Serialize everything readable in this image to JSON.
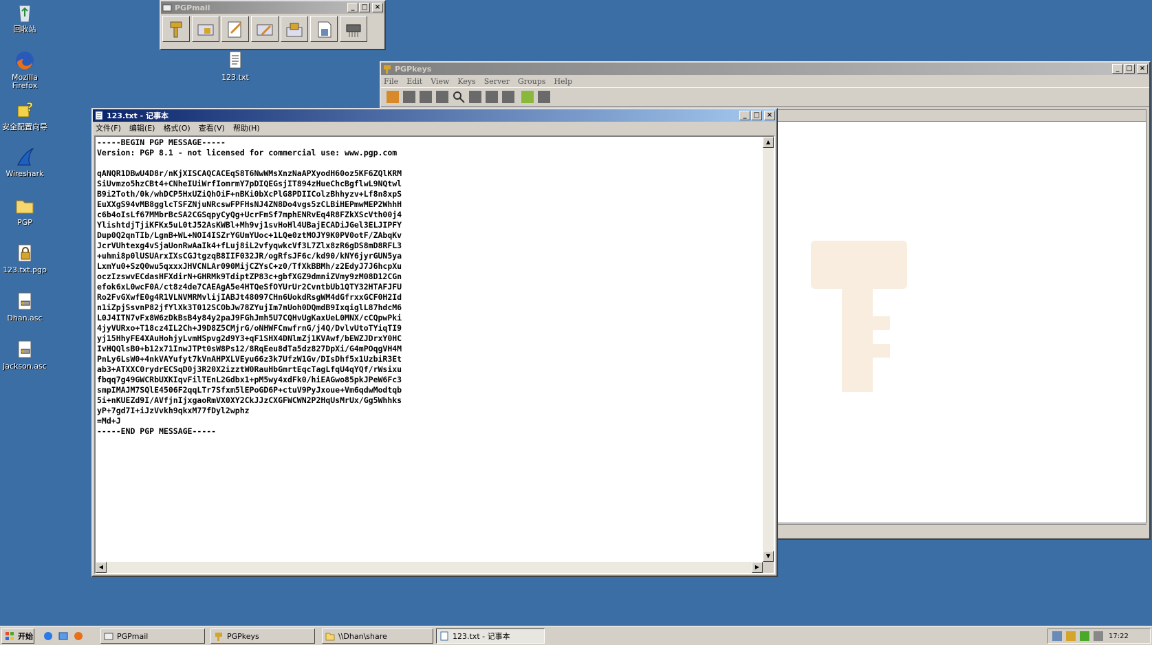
{
  "desktop": {
    "icons": [
      {
        "label": "回收站",
        "icon": "recycle-bin-icon"
      },
      {
        "label": "Mozilla Firefox",
        "icon": "firefox-icon"
      },
      {
        "label": "安全配置向导",
        "icon": "security-wizard-icon"
      },
      {
        "label": "Wireshark",
        "icon": "wireshark-icon"
      },
      {
        "label": "PGP",
        "icon": "folder-icon"
      },
      {
        "label": "123.txt.pgp",
        "icon": "pgp-file-icon"
      },
      {
        "label": "Dhan.asc",
        "icon": "asc-file-icon"
      },
      {
        "label": "jackson.asc",
        "icon": "asc-file-icon"
      },
      {
        "label": "123.txt",
        "icon": "text-file-icon"
      }
    ]
  },
  "pgpmail": {
    "title": "PGPmail"
  },
  "pgpkeys": {
    "title": "PGPkeys",
    "menu": [
      "File",
      "Edit",
      "View",
      "Keys",
      "Server",
      "Groups",
      "Help"
    ]
  },
  "notepad": {
    "title": "123.txt - 记事本",
    "menu": [
      "文件(F)",
      "编辑(E)",
      "格式(O)",
      "查看(V)",
      "帮助(H)"
    ],
    "content": "-----BEGIN PGP MESSAGE-----\nVersion: PGP 8.1 - not licensed for commercial use: www.pgp.com\n\nqANQR1DBwU4D8r/nKjXISCAQCACEqS8T6NwWMsXnzNaAPXyodH60oz5KF6ZQlKRM\nSiUvmzo5hzCBt4+CNheIUiWrfIomrmY7pDIQEGsjIT894zHueChcBgflwL9NQtwl\nB9i2Toth/0k/whDCP5HxUZiQhOiF+nBKi0bXcPlG8PDIIColzBhhyzv+Lf8n8xpS\nEuXXgS94vMB8gglcTSFZNjuNRcswFPFHsNJ4ZN8Do4vgs5zCLBiHEPmwMEP2WhhH\nc6b4oIsLf67MMbrBcSA2CGSqpyCyQg+UcrFmSf7mphENRvEq4R8FZkXScVth00j4\nYlishtdjTjiKFKx5uL0tJ52AsKWBl+Mh9vj1svHoHl4UBajECADiJGel3ELJIPFY\nDup0Q2qnTIb/LgnB+WL+NOI4ISZrYGUmYUoc+1LQe0ztMOJY9K0PV0otF/ZAbqKv\nJcrVUhtexg4vSjaUonRwAaIk4+fLuj8iL2vfyqwkcVf3L7Zlx8zR6gDS8mD8RFL3\n+uhmi8p0lUSUArxIXsCGJtgzqB8IIF032JR/ogRfsJF6c/kd90/kNY6jyrGUN5ya\nLxmYu0+SzQ0wu5qxxxJHVCNLAr090MijCZYsC+z0/TfXkBBMh/z2EdyJ7J6hcpXu\noczIzswvECdasHFXdirN+GHRMk9TdiptZP83c+gbfXGZ9dmniZVmy9zM08D12CGn\nefok6xL0wcF0A/ct8z4de7CAEAgA5e4HTQeSfOYUrUr2CvntbUb1QTY32HTAFJFU\nRo2FvGXwfE0g4R1VLNVMRMvlijIABJt48097CHn6UokdRsgWM4dGfrxxGCF0H2Id\nn1iZpjSsvnP82jfYlXk3T012SCObJw78ZYujIm7nUoh0DQmdB9IxqiglL87hdcM6\nL0J4ITN7vFx8W6zDkBsB4y84y2paJ9FGhJmh5U7CQHvUgKaxUeL0MNX/cCQpwPki\n4jyVURxo+T18cz4IL2Ch+J9D8Z5CMjrG/oNHWFCnwfrnG/j4Q/DvlvUtoTYiqTI9\nyj15HhyFE4XAuHohjyLvmHSpvg2d9Y3+qF1SHX4DNlmZj1KVAwf/bEWZJDrxY0HC\nIvHQQlsB0+b12x71InwJTPt0sW8Ps12/8RqEeu8dTa5dz827DpXi/G4mPOqgVH4M\nPnLy6LsW0+4nkVAYufyt7kVnAHPXLVEyu66z3k7UfzW1Gv/DIsDhf5x1UzbiR3Et\nab3+ATXXC0rydrECSqD0j3R20X2izztW0RauHbGmrtEqcTagLfqU4qYQf/rWsixu\nfbqq7g49GWCRbUXKIqvFilTEnL2Gdbx1+pM5wy4xdFk0/hiEAGwo85pkJPeW6Fc3\nsmpIMAJM7SQlE4506F2qqLTr7Sfxm5lEPoGD6P+ctuV9PyJxoue+Vm6qdwModtqb\n5i+nKUEZd9I/AVfjnIjxgaoRmVX0XY2CkJJzCXGFWCWN2P2HqUsMrUx/Gg5Whhks\nyP+7gd7I+iJzVvkh9qkxM77fDyl2wphz\n=Md+J\n-----END PGP MESSAGE-----"
  },
  "taskbar": {
    "start": "开始",
    "tasks": [
      "PGPmail",
      "PGPkeys",
      "\\\\Dhan\\share",
      "123.txt - 记事本"
    ],
    "clock": "17:22"
  },
  "colors": {
    "desktop": "#3a6ea5",
    "active_title": "#0a246a",
    "face": "#d4d0c8"
  }
}
